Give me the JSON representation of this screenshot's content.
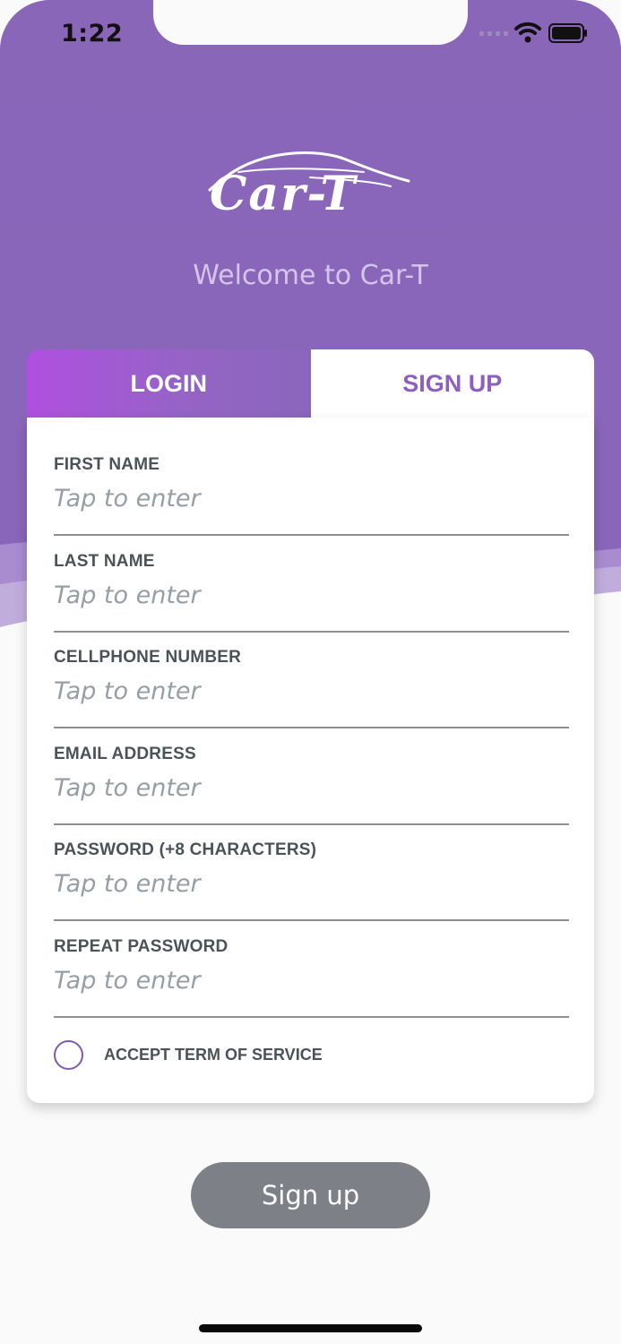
{
  "status_bar": {
    "time": "1:22",
    "icons": [
      "signal-icon",
      "wifi-icon",
      "battery-icon"
    ]
  },
  "header": {
    "logo_text": "Car-T",
    "welcome": "Welcome to Car-T"
  },
  "tabs": {
    "login": "LOGIN",
    "signup": "SIGN UP",
    "active": "signup"
  },
  "form": {
    "fields": [
      {
        "label": "FIRST NAME",
        "placeholder": "Tap to enter",
        "value": ""
      },
      {
        "label": "LAST NAME",
        "placeholder": "Tap to enter",
        "value": ""
      },
      {
        "label": "CELLPHONE NUMBER",
        "placeholder": "Tap to enter",
        "value": ""
      },
      {
        "label": "EMAIL ADDRESS",
        "placeholder": "Tap to enter",
        "value": ""
      },
      {
        "label": "PASSWORD (+8 CHARACTERS)",
        "placeholder": "Tap to enter",
        "value": ""
      },
      {
        "label": "REPEAT PASSWORD",
        "placeholder": "Tap to enter",
        "value": ""
      }
    ],
    "terms_label": "ACCEPT TERM OF SERVICE",
    "terms_checked": false
  },
  "actions": {
    "signup_button": "Sign up"
  },
  "colors": {
    "brand_purple": "#8a66bb",
    "tab_gradient_start": "#b04fe0",
    "signup_tab_text": "#8e5fbf",
    "button_disabled": "#7e8087"
  }
}
